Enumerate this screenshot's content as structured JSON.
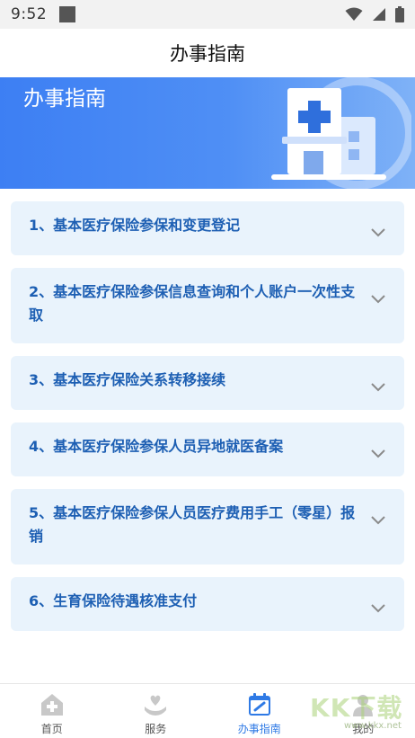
{
  "status_bar": {
    "time": "9:52"
  },
  "header": {
    "title": "办事指南"
  },
  "banner": {
    "title": "办事指南"
  },
  "guide_items": [
    {
      "text": "1、基本医疗保险参保和变更登记"
    },
    {
      "text": "2、基本医疗保险参保信息查询和个人账户一次性支取"
    },
    {
      "text": "3、基本医疗保险关系转移接续"
    },
    {
      "text": "4、基本医疗保险参保人员异地就医备案"
    },
    {
      "text": "5、基本医疗保险参保人员医疗费用手工（零星）报销"
    },
    {
      "text": "6、生育保险待遇核准支付"
    }
  ],
  "bottom_nav": {
    "tabs": [
      {
        "label": "首页",
        "icon": "home-plus-icon",
        "active": false
      },
      {
        "label": "服务",
        "icon": "hand-heart-icon",
        "active": false
      },
      {
        "label": "办事指南",
        "icon": "calendar-check-icon",
        "active": true
      },
      {
        "label": "我的",
        "icon": "person-icon",
        "active": false
      }
    ]
  },
  "watermark": {
    "text": "KK下载",
    "url": "www.kkx.net"
  },
  "colors": {
    "accent": "#2f7ae5",
    "item_bg": "#e9f3fc",
    "item_text": "#1d5fb3",
    "banner": "#4a8bf5"
  }
}
